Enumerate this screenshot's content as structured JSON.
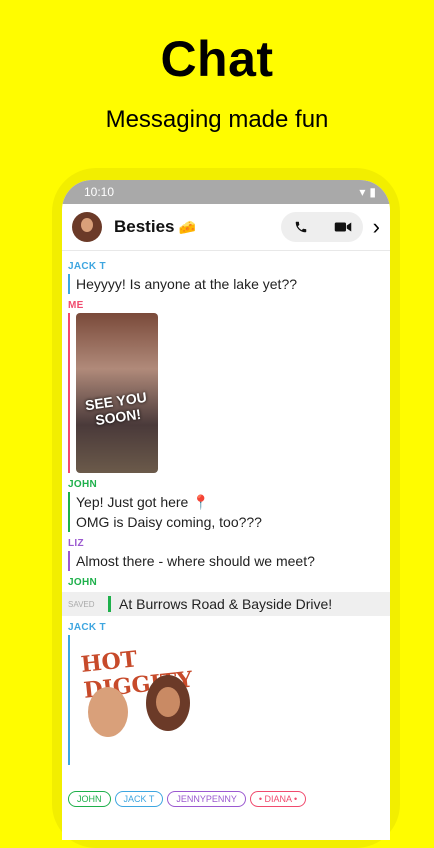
{
  "page": {
    "title": "Chat",
    "subtitle": "Messaging made fun"
  },
  "status": {
    "time": "10:10"
  },
  "header": {
    "chat_name": "Besties",
    "emoji": "🧀"
  },
  "messages": {
    "m1_sender": "JACK T",
    "m1_text": "Heyyyy! Is anyone at the lake yet??",
    "m2_sender": "ME",
    "m2_photo_text": "SEE YOU SOON!",
    "m3_sender": "JOHN",
    "m3_text1": "Yep! Just got here 📍",
    "m3_text2": "OMG is Daisy coming, too???",
    "m4_sender": "LIZ",
    "m4_text": "Almost there - where should we meet?",
    "m5_sender": "JOHN",
    "m5_saved": "SAVED",
    "m5_text": "At Burrows Road & Bayside Drive!",
    "m6_sender": "JACK T",
    "m6_sticker": "HOT DIGGITY"
  },
  "presence": [
    "JOHN",
    "JACK T",
    "JENNYPENNY",
    "• DIANA •"
  ],
  "colors": {
    "brand": "#FFFC00",
    "jack": "#3EA6E0",
    "me": "#F04B6E",
    "john": "#1EB04B",
    "liz": "#9B59D0",
    "jenny": "#9B59D0",
    "diana": "#F04B6E"
  }
}
